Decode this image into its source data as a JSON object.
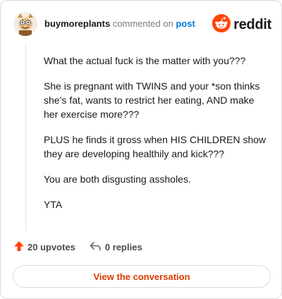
{
  "comment": {
    "username": "buymoreplants",
    "action_text": "commented on",
    "post_link": "post",
    "paragraphs": [
      "What the actual fuck is the matter with you???",
      "She is pregnant with TWINS and your *son thinks she’s fat, wants to restrict her eating, AND make her exercise more???",
      "PLUS he finds it gross when HIS CHILDREN show they are developing healthily and kick???",
      "You are both disgusting assholes.",
      "YTA"
    ]
  },
  "brand": {
    "name": "reddit",
    "icon": "reddit-snoo-icon",
    "color": "#ff4500"
  },
  "actions": {
    "upvotes": "20 upvotes",
    "upvote_icon": "upvote-arrow-icon",
    "replies": "0 replies",
    "reply_icon": "reply-arrow-icon"
  },
  "cta": {
    "label": "View the conversation"
  },
  "colors": {
    "accent": "#d93a00",
    "link": "#0079d3",
    "upvote": "#ff4500"
  }
}
